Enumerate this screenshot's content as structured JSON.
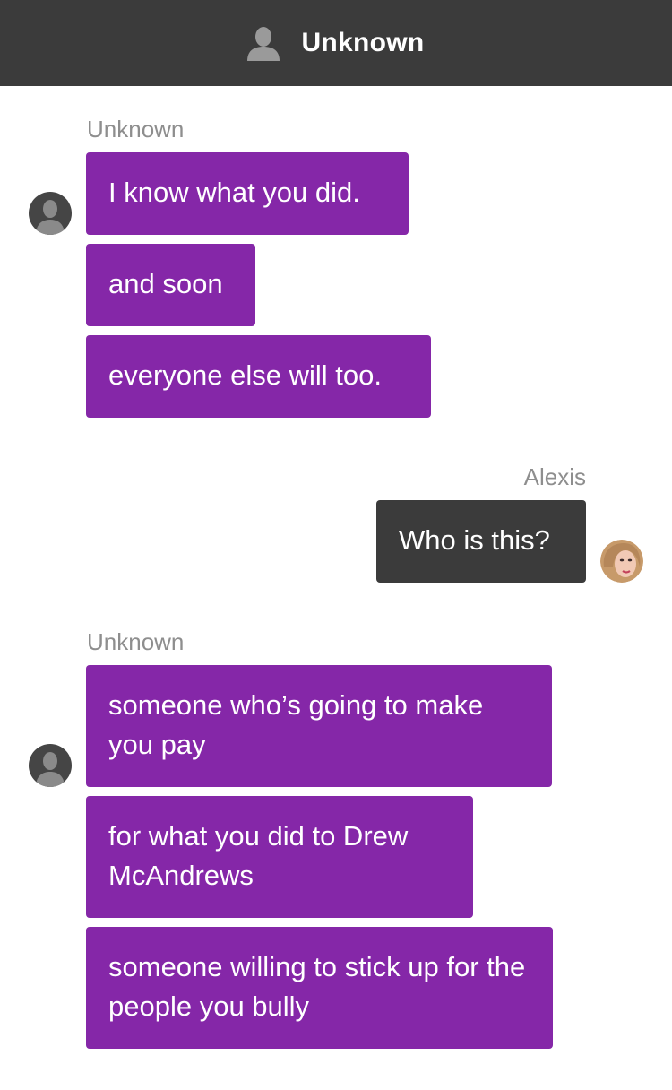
{
  "header": {
    "title": "Unknown",
    "icon": "person-icon"
  },
  "thread": {
    "group1": {
      "sender": "Unknown",
      "messages": [
        "I know what you did.",
        "and soon",
        "everyone else will too."
      ]
    },
    "group2": {
      "sender": "Alexis",
      "messages": [
        "Who is this?"
      ]
    },
    "group3": {
      "sender": "Unknown",
      "messages": [
        "someone who’s going to make you pay",
        "for what you did to Drew McAndrews",
        "someone willing to stick up for the people you bully"
      ]
    }
  },
  "colors": {
    "header_bg": "#3b3b3b",
    "incoming_bubble": "#8527a8",
    "outgoing_bubble": "#3b3b3b",
    "sender_label": "#8e8e8e"
  }
}
